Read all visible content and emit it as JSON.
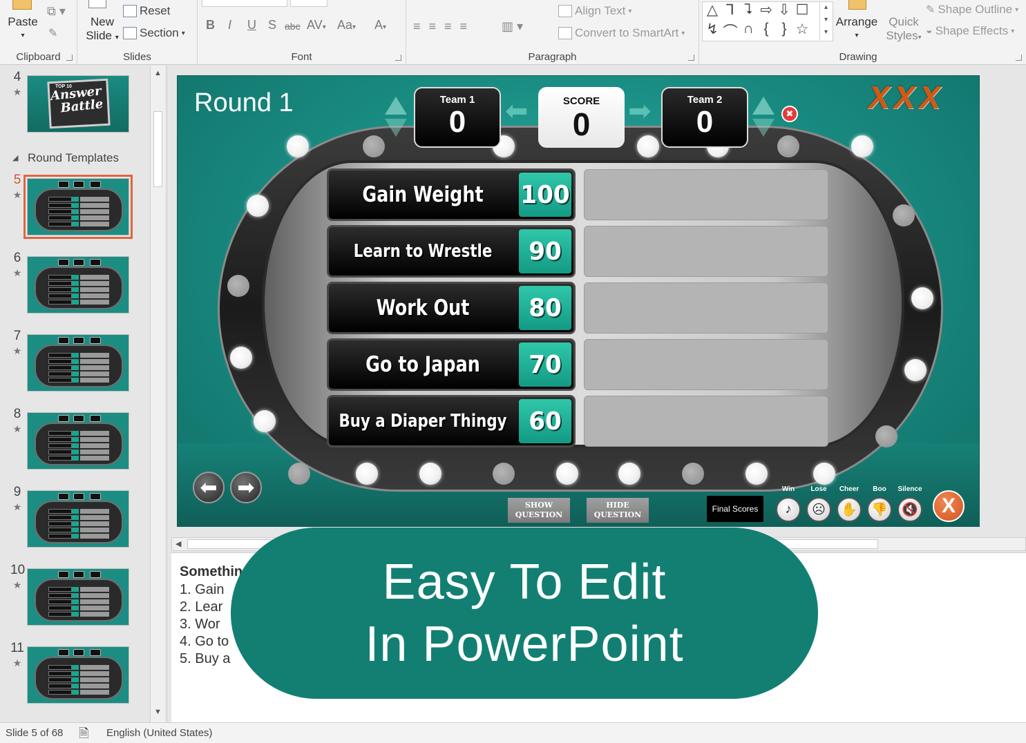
{
  "ribbon": {
    "clipboard": {
      "paste": "Paste",
      "label": "Clipboard"
    },
    "slides": {
      "new_slide_1": "New",
      "new_slide_2": "Slide",
      "reset": "Reset",
      "section": "Section",
      "label": "Slides"
    },
    "font": {
      "bold": "B",
      "italic": "I",
      "underline": "U",
      "shadow": "S",
      "strike": "abc",
      "spacing": "AV",
      "case": "Aa",
      "color": "A",
      "label": "Font"
    },
    "paragraph": {
      "align_text": "Align Text",
      "smartart": "Convert to SmartArt",
      "label": "Paragraph"
    },
    "drawing": {
      "arrange": "Arrange",
      "quick_styles_1": "Quick",
      "quick_styles_2": "Styles",
      "shape_outline": "Shape Outline",
      "shape_effects": "Shape Effects",
      "label": "Drawing",
      "shapes": [
        "△",
        "⅂",
        "⮧",
        "⇨",
        "⇩",
        "☐",
        "↯",
        "⌒",
        "∩",
        "{",
        "}",
        "☆"
      ]
    }
  },
  "thumbnails": {
    "section_header": "Round Templates",
    "items": [
      {
        "num": "4"
      },
      {
        "num": "5"
      },
      {
        "num": "6"
      },
      {
        "num": "7"
      },
      {
        "num": "8"
      },
      {
        "num": "9"
      },
      {
        "num": "10"
      },
      {
        "num": "11"
      }
    ],
    "logo_text_1": "Answer",
    "logo_text_2": "Battle",
    "logo_small": "TOP 10"
  },
  "slide": {
    "round_title": "Round 1",
    "strikes": "XXX",
    "team1": {
      "label": "Team 1",
      "score": "0"
    },
    "score": {
      "label": "SCORE",
      "value": "0"
    },
    "team2": {
      "label": "Team 2",
      "score": "0"
    },
    "answers": [
      {
        "text": "Gain Weight",
        "points": "100"
      },
      {
        "text": "Learn to Wrestle",
        "points": "90"
      },
      {
        "text": "Work Out",
        "points": "80"
      },
      {
        "text": "Go to Japan",
        "points": "70"
      },
      {
        "text": "Buy a Diaper Thingy",
        "points": "60"
      }
    ],
    "show_question_1": "SHOW",
    "show_question_2": "QUESTION",
    "hide_question_1": "HIDE",
    "hide_question_2": "QUESTION",
    "final_scores": "Final Scores",
    "sounds": [
      {
        "label": "Win",
        "icon": "♪"
      },
      {
        "label": "Lose",
        "icon": "☹"
      },
      {
        "label": "Cheer",
        "icon": "✋"
      },
      {
        "label": "Boo",
        "icon": "👎"
      },
      {
        "label": "Silence",
        "icon": "🔇"
      }
    ],
    "close": "X"
  },
  "notes": {
    "title": "Somethin",
    "lines": [
      "1.   Gain",
      "2.   Lear",
      "3.   Wor",
      "4.   Go to",
      "5.   Buy a"
    ]
  },
  "banner": {
    "line1": "Easy To Edit",
    "line2": "In PowerPoint"
  },
  "status": {
    "slide": "Slide 5 of 68",
    "language": "English (United States)"
  }
}
